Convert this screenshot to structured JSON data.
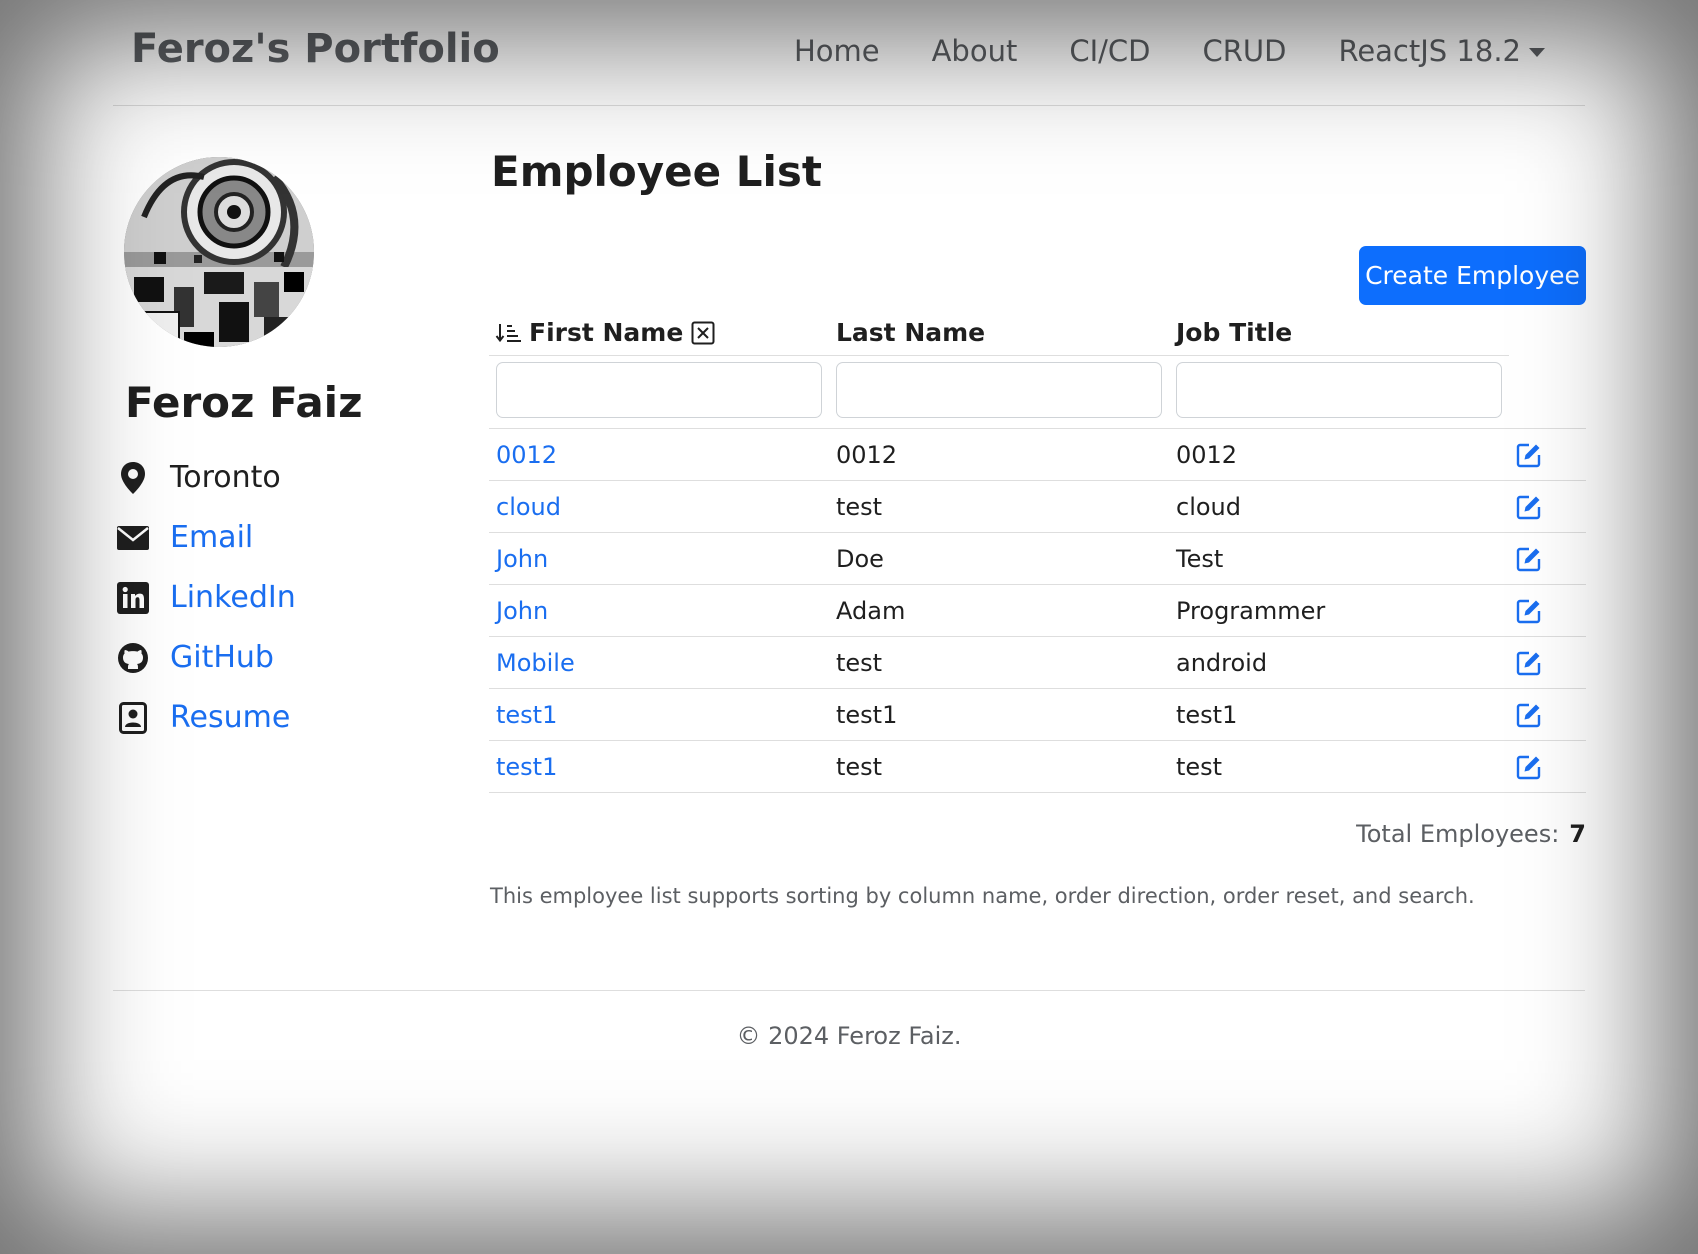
{
  "navbar": {
    "brand": "Feroz's Portfolio",
    "links": [
      "Home",
      "About",
      "CI/CD",
      "CRUD",
      "ReactJS 18.2"
    ]
  },
  "profile": {
    "name": "Feroz Faiz",
    "location": "Toronto",
    "email_label": "Email",
    "linkedin_label": "LinkedIn",
    "github_label": "GitHub",
    "resume_label": "Resume"
  },
  "main": {
    "title": "Employee List",
    "create_button": "Create Employee",
    "columns": [
      "First Name",
      "Last Name",
      "Job Title"
    ],
    "rows": [
      {
        "first": "0012",
        "last": "0012",
        "job": "0012"
      },
      {
        "first": "cloud",
        "last": "test",
        "job": "cloud"
      },
      {
        "first": "John",
        "last": "Doe",
        "job": "Test"
      },
      {
        "first": "John",
        "last": "Adam",
        "job": "Programmer"
      },
      {
        "first": "Mobile",
        "last": "test",
        "job": "android"
      },
      {
        "first": "test1",
        "last": "test1",
        "job": "test1"
      },
      {
        "first": "test1",
        "last": "test",
        "job": "test"
      }
    ],
    "total_label": "Total Employees:",
    "total_value": "7",
    "description": "This employee list supports sorting by column name, order direction, order reset, and search."
  },
  "footer": {
    "text": "© 2024 Feroz Faiz."
  },
  "colors": {
    "link": "#1a6ef0",
    "primary_button": "#0d6efd",
    "nav_text": "#5c5f63"
  },
  "icons": {
    "sort": "sort-ascending-icon",
    "clear": "clear-sort-icon",
    "location": "map-pin-icon",
    "email": "envelope-icon",
    "linkedin": "linkedin-icon",
    "github": "github-icon",
    "resume": "resume-icon",
    "edit": "edit-icon"
  }
}
